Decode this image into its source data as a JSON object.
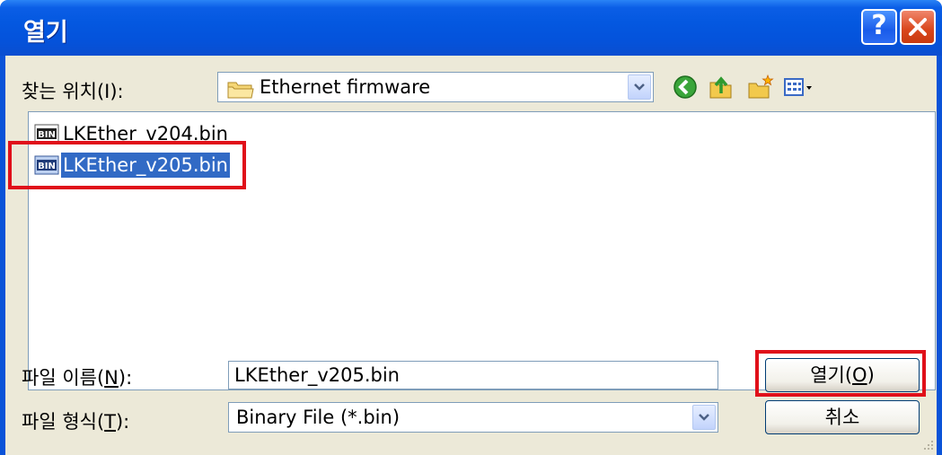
{
  "window": {
    "title": "열기",
    "help_label": "?"
  },
  "toolbar": {
    "look_in_label": "찾는 위치(I):",
    "look_in_value": "Ethernet firmware",
    "icons": [
      "back-icon",
      "up-folder-icon",
      "new-folder-icon",
      "view-menu-icon"
    ]
  },
  "files": [
    {
      "name": "LKEther_v204.bin",
      "icon": "bin-file-icon",
      "selected": false
    },
    {
      "name": "LKEther_v205.bin",
      "icon": "bin-file-icon",
      "selected": true
    }
  ],
  "filename": {
    "label": "파일 이름(N):",
    "value": "LKEther_v205.bin"
  },
  "filetype": {
    "label": "파일 형식(T):",
    "value": "Binary File (*.bin)"
  },
  "buttons": {
    "open_label": "열기(O)",
    "cancel_label": "취소"
  },
  "colors": {
    "titlebar": "#0458e0",
    "dialog_bg": "#ece9d8",
    "selection": "#316ac5",
    "highlight": "#e0101a"
  }
}
